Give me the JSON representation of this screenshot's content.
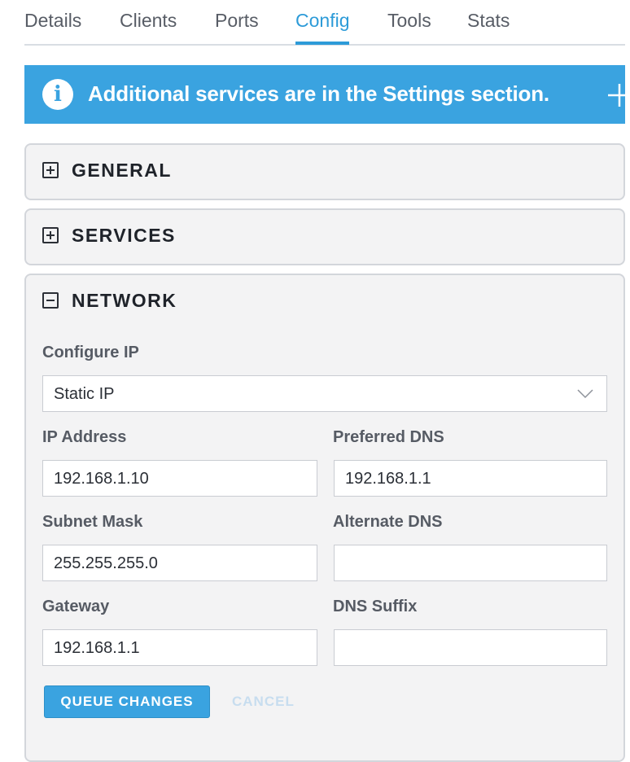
{
  "tabs": [
    {
      "label": "Details"
    },
    {
      "label": "Clients"
    },
    {
      "label": "Ports"
    },
    {
      "label": "Config",
      "active": true
    },
    {
      "label": "Tools"
    },
    {
      "label": "Stats"
    }
  ],
  "banner": {
    "icon": "info-icon",
    "icon_glyph": "i",
    "text": "Additional services are in the Settings section.",
    "action_icon": "plus-icon"
  },
  "panels": {
    "general": {
      "title": "GENERAL",
      "state": "collapsed"
    },
    "services": {
      "title": "SERVICES",
      "state": "collapsed"
    },
    "network": {
      "title": "NETWORK",
      "state": "expanded",
      "configure_ip": {
        "label": "Configure IP",
        "value": "Static IP"
      },
      "ip_address": {
        "label": "IP Address",
        "value": "192.168.1.10"
      },
      "preferred_dns": {
        "label": "Preferred DNS",
        "value": "192.168.1.1"
      },
      "subnet_mask": {
        "label": "Subnet Mask",
        "value": "255.255.255.0"
      },
      "alternate_dns": {
        "label": "Alternate DNS",
        "value": ""
      },
      "gateway": {
        "label": "Gateway",
        "value": "192.168.1.1"
      },
      "dns_suffix": {
        "label": "DNS Suffix",
        "value": ""
      },
      "queue_button": "QUEUE CHANGES",
      "cancel_button": "CANCEL"
    }
  },
  "colors": {
    "accent": "#2d9bd8",
    "banner_bg": "#3aa3e0",
    "panel_bg": "#f3f3f4",
    "cancel_disabled": "#c7ddef"
  }
}
